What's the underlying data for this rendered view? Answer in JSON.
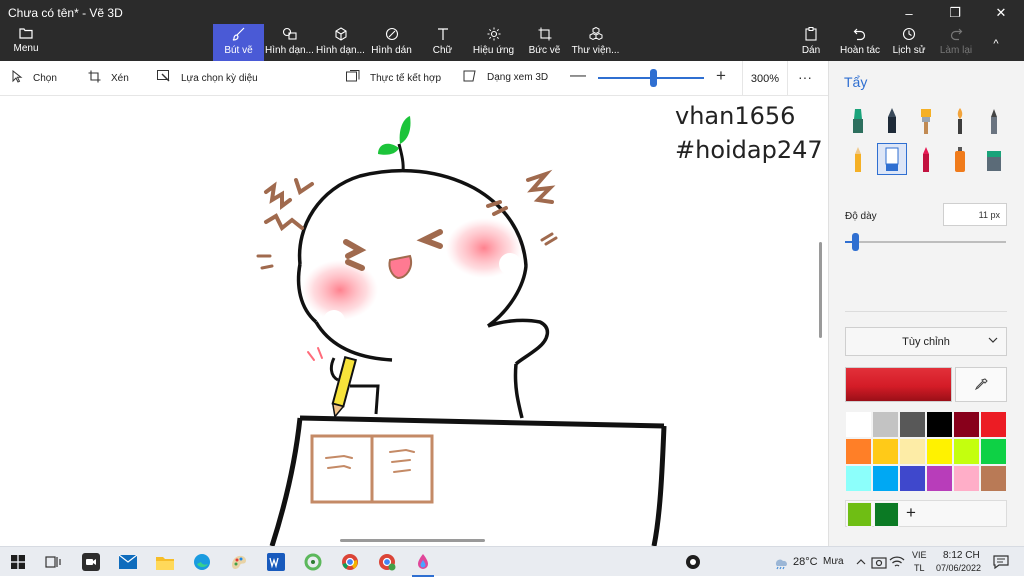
{
  "window": {
    "title": "Chưa có tên* - Vẽ 3D",
    "minimize": "–",
    "maximize": "❐",
    "close": "✕"
  },
  "menu": {
    "label": "Menu",
    "icon": "folder-icon"
  },
  "ribbon": {
    "tools": [
      {
        "id": "brushes",
        "label": "Bút vẽ",
        "icon": "brush-icon",
        "active": true
      },
      {
        "id": "shapes2d",
        "label": "Hình dạn...",
        "icon": "shapes-2d-icon"
      },
      {
        "id": "shapes3d",
        "label": "Hình dạn...",
        "icon": "cube-icon"
      },
      {
        "id": "stickers",
        "label": "Hình dán",
        "icon": "sticker-icon"
      },
      {
        "id": "text",
        "label": "Chữ",
        "icon": "text-icon"
      },
      {
        "id": "effects",
        "label": "Hiệu ứng",
        "icon": "sun-icon"
      },
      {
        "id": "canvas",
        "label": "Bức vẽ",
        "icon": "canvas-icon"
      },
      {
        "id": "library",
        "label": "Thư viện...",
        "icon": "library-icon"
      }
    ],
    "right_tools": [
      {
        "id": "paste",
        "label": "Dán",
        "icon": "paste-icon"
      },
      {
        "id": "undo",
        "label": "Hoàn tác",
        "icon": "undo-icon"
      },
      {
        "id": "history",
        "label": "Lịch sử",
        "icon": "history-icon"
      },
      {
        "id": "redo",
        "label": "Làm lại",
        "icon": "redo-icon",
        "disabled": true
      }
    ],
    "collapse_icon": "^"
  },
  "toolbar": {
    "select": "Chọn",
    "crop": "Xén",
    "magic_select": "Lựa chọn kỳ diệu",
    "mixed_reality": "Thực tế kết hợp",
    "view_3d": "Dạng xem 3D",
    "zoom_minus": "—",
    "zoom_plus": "+",
    "zoom": "300%",
    "zoom_level": 0.52,
    "more": "···"
  },
  "canvas": {
    "text_line1": "vhan1656",
    "text_line2": "#hoidap247"
  },
  "panel": {
    "title": "Tẩy",
    "thickness_label": "Độ dày",
    "thickness_value": "11 px",
    "color_mode": "Tùy chỉnh",
    "selected_color": "#d41c27",
    "palette": [
      "#ffffff",
      "#c3c3c3",
      "#585858",
      "#000000",
      "#88001b",
      "#ec1c24",
      "#ff7f27",
      "#ffca18",
      "#fdeca6",
      "#fff200",
      "#c4ff0e",
      "#0ed145",
      "#8cfffb",
      "#00a8f3",
      "#3f48cc",
      "#b83dba",
      "#ffaec8",
      "#b97a56"
    ],
    "custom_colors": [
      "#6fbe14",
      "#0b7a24"
    ],
    "add_color": "+"
  },
  "taskbar": {
    "weather_temp": "28°C",
    "weather_text": "Mưa",
    "lang_1": "VIE",
    "lang_2": "TL",
    "time": "8:12 CH",
    "date": "07/06/2022"
  }
}
